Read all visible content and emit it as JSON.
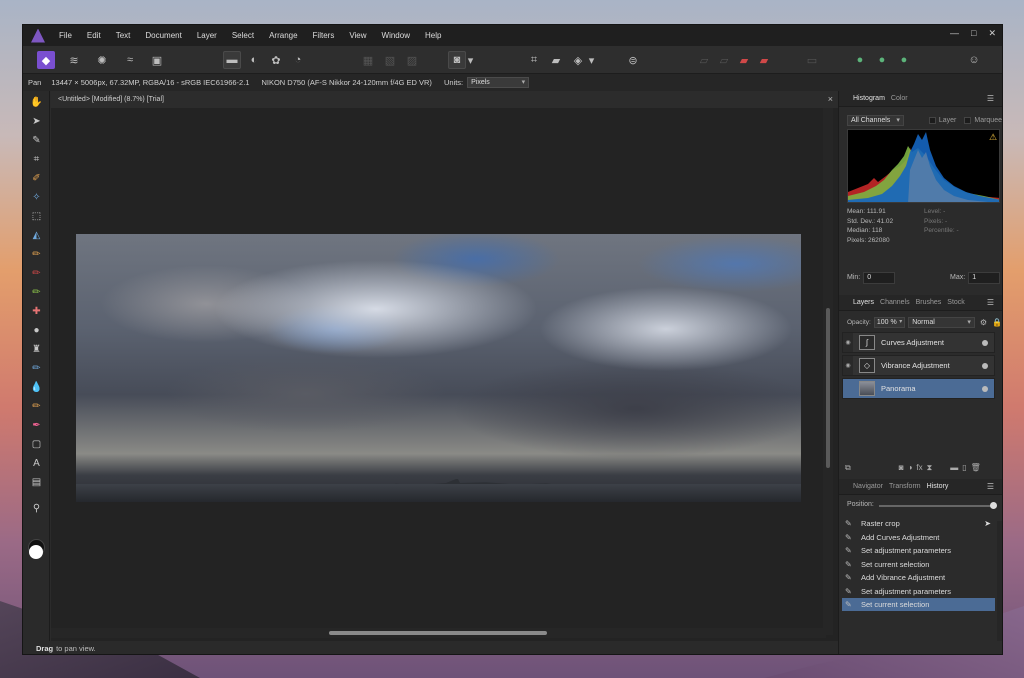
{
  "menubar": {
    "items": [
      "File",
      "Edit",
      "Text",
      "Document",
      "Layer",
      "Select",
      "Arrange",
      "Filters",
      "View",
      "Window",
      "Help"
    ]
  },
  "window_controls": {
    "minimize": "—",
    "maximize": "□",
    "close": "✕"
  },
  "context_bar": {
    "tool": "Pan",
    "info": "13447 × 5006px, 67.32MP, RGBA/16 - sRGB IEC61966-2.1",
    "camera": "NIKON D750 (AF-S Nikkor 24-120mm f/4G ED VR)",
    "units_label": "Units:",
    "units_value": "Pixels"
  },
  "document": {
    "tab_title": "<Untitled> [Modified] (8.7%) [Trial]",
    "close": "×"
  },
  "histogram_panel": {
    "tabs": [
      "Histogram",
      "Color"
    ],
    "channel": "All Channels",
    "layer_label": "Layer",
    "marquee_label": "Marquee",
    "stats_left": [
      "Mean: 111.91",
      "Std. Dev.: 41.02",
      "Median: 118",
      "Pixels: 262080"
    ],
    "stats_right": [
      "Level: -",
      "Pixels: -",
      "Percentile: -"
    ],
    "min_label": "Min:",
    "min_value": "0",
    "max_label": "Max:",
    "max_value": "1"
  },
  "layers_panel": {
    "tabs": [
      "Layers",
      "Channels",
      "Brushes",
      "Stock"
    ],
    "opacity_label": "Opacity:",
    "opacity_value": "100 %",
    "blend_mode": "Normal",
    "layers": [
      {
        "name": "Curves Adjustment",
        "icon": "curves-icon",
        "selected": false
      },
      {
        "name": "Vibrance Adjustment",
        "icon": "vibrance-icon",
        "selected": false
      },
      {
        "name": "Panorama",
        "icon": "image-thumbnail",
        "selected": true
      }
    ]
  },
  "history_panel": {
    "tabs": [
      "Navigator",
      "Transform",
      "History"
    ],
    "position_label": "Position:",
    "position_value": 1.0,
    "items": [
      "Raster crop",
      "Add Curves Adjustment",
      "Set adjustment parameters",
      "Set current selection",
      "Add Vibrance Adjustment",
      "Set adjustment parameters",
      "Set current selection"
    ],
    "selected_index": 6
  },
  "status": {
    "bold": "Drag",
    "text": "to pan view."
  }
}
